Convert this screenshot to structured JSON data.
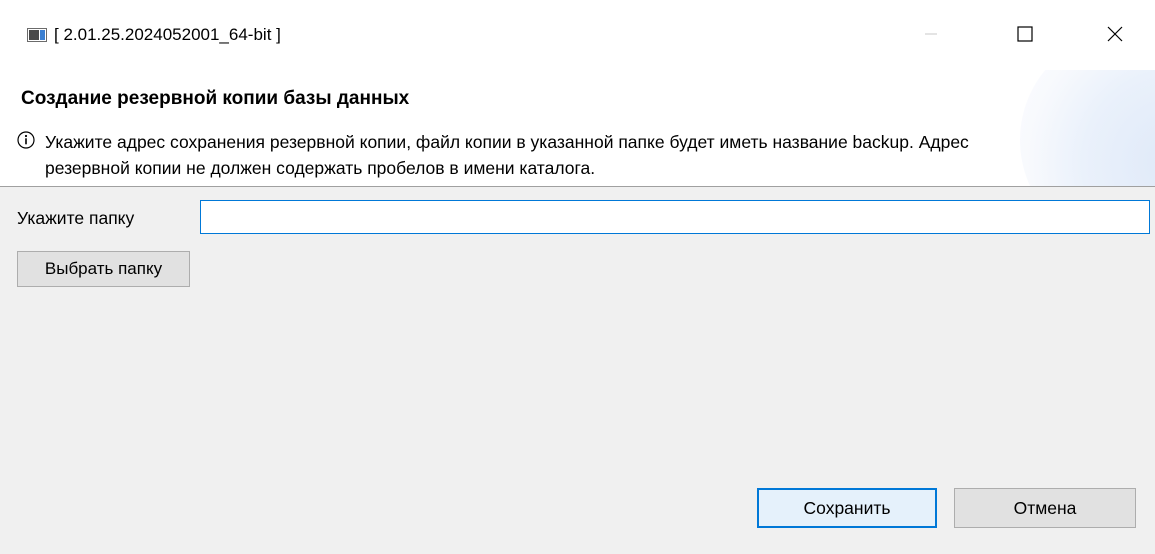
{
  "window": {
    "title": "[ 2.01.25.2024052001_64-bit ]",
    "controls": {
      "minimize_icon": "minimize-icon",
      "maximize_icon": "maximize-icon",
      "close_icon": "close-icon"
    }
  },
  "banner": {
    "title": "Создание резервной копии базы данных",
    "info_icon": "info-icon",
    "description": "Укажите адрес сохранения резервной копии, файл копии в указанной папке будет иметь название backup. Адрес резервной копии не должен содержать пробелов в имени каталога."
  },
  "form": {
    "folder_label": "Укажите папку",
    "folder_value": "",
    "choose_folder_label": "Выбрать папку"
  },
  "footer": {
    "save_label": "Сохранить",
    "cancel_label": "Отмена"
  },
  "colors": {
    "accent": "#0078d7",
    "background": "#f0f0f0",
    "button_face": "#e1e1e1"
  }
}
